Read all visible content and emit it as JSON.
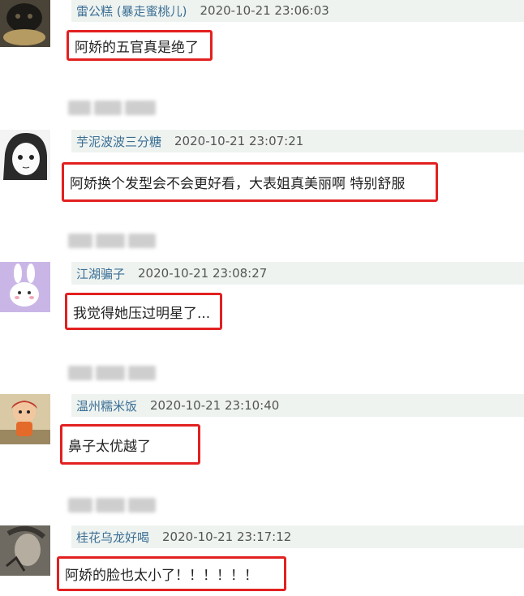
{
  "comments": [
    {
      "user": "雷公糕 (暴走蜜桃儿)",
      "time": "2020-10-21 23:06:03",
      "text": "阿娇的五官真是绝了",
      "avatar": "dark-pet-avatar"
    },
    {
      "user": "芋泥波波三分糖",
      "time": "2020-10-21 23:07:21",
      "text": "阿娇换个发型会不会更好看，大表姐真美丽啊 特别舒服",
      "avatar": "manga-girl-avatar"
    },
    {
      "user": "江湖骗子",
      "time": "2020-10-21 23:08:27",
      "text": "我觉得她压过明星了...",
      "avatar": "bunny-avatar"
    },
    {
      "user": "温州糯米饭",
      "time": "2020-10-21 23:10:40",
      "text": "鼻子太优越了",
      "avatar": "cartoon-kid-avatar"
    },
    {
      "user": "桂花乌龙好喝",
      "time": "2020-10-21 23:17:12",
      "text": "阿娇的脸也太小了！！！！！！",
      "avatar": "sketch-avatar"
    }
  ],
  "colors": {
    "highlight": "#e32020",
    "username": "#3b6e94",
    "header_bg": "#eef3f0"
  }
}
